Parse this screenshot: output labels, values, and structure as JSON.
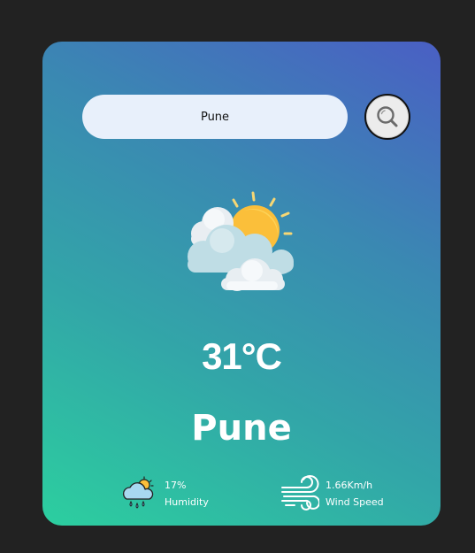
{
  "search": {
    "value": "Pune",
    "button_icon": "search-icon"
  },
  "weather": {
    "icon": "partly-cloudy-icon",
    "temperature": "31°C",
    "city": "Pune"
  },
  "details": {
    "humidity": {
      "icon": "humidity-rain-icon",
      "value": "17%",
      "label": "Humidity"
    },
    "wind": {
      "icon": "wind-icon",
      "value": "1.66Km/h",
      "label": "Wind Speed"
    }
  },
  "colors": {
    "page_background": "#222222",
    "gradient_start": "#2ccf9f",
    "gradient_end": "#4a5fc4",
    "input_background": "#e8f0fb",
    "text": "#ffffff"
  }
}
